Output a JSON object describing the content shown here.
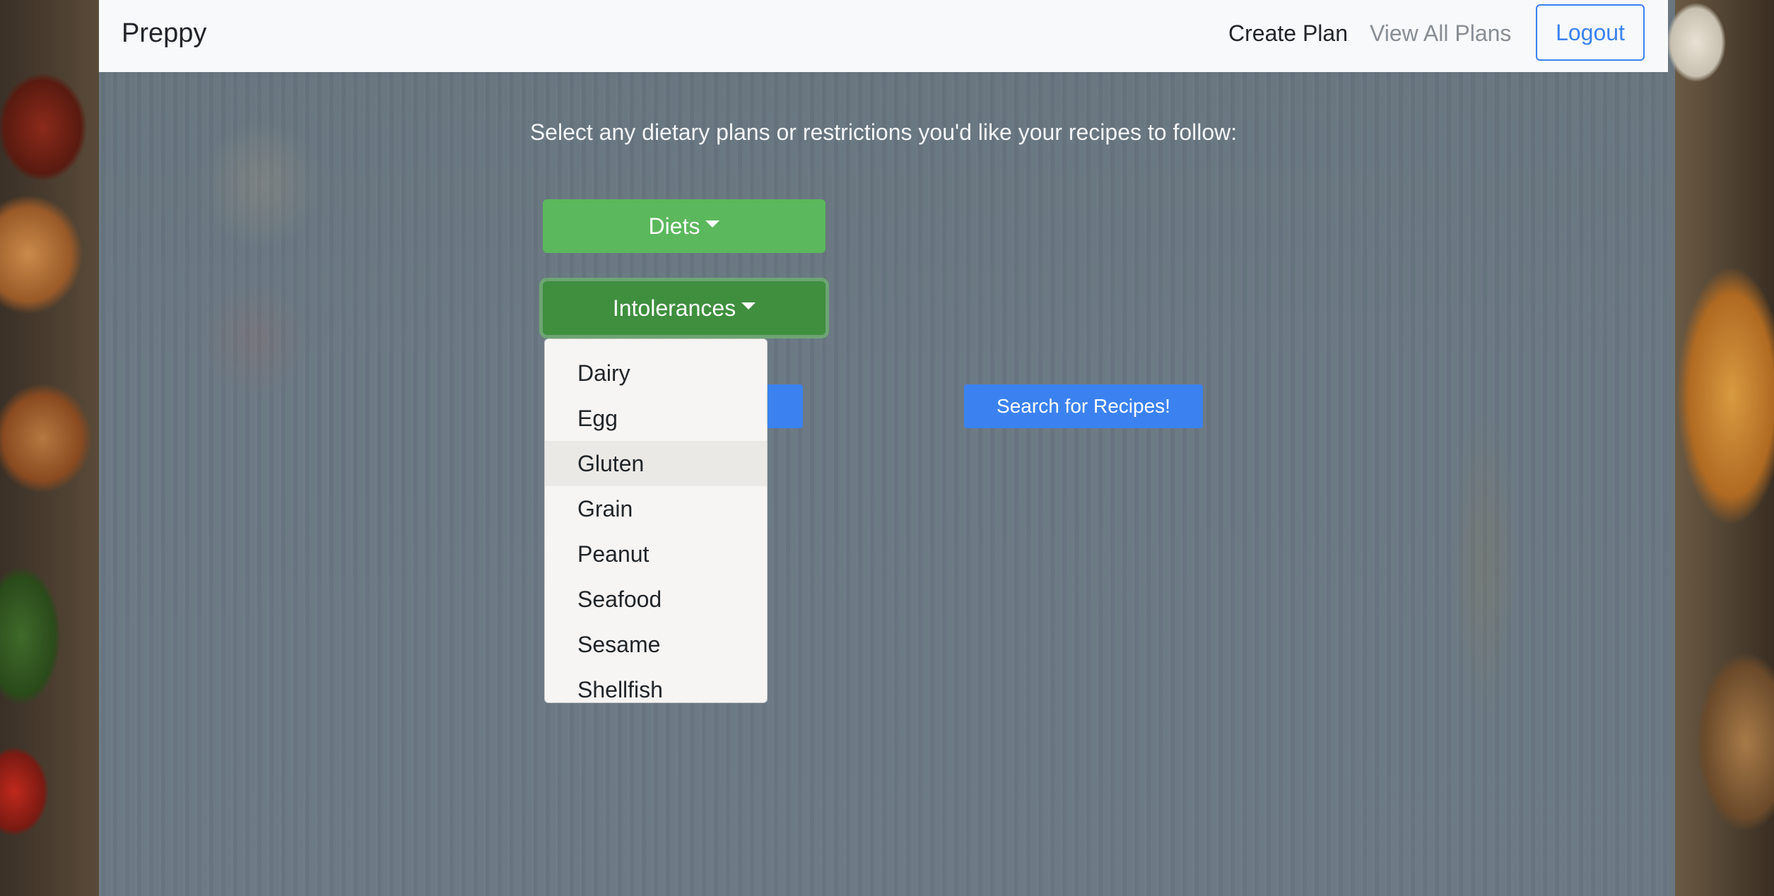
{
  "navbar": {
    "brand": "Preppy",
    "links": {
      "create_plan": "Create Plan",
      "view_all_plans": "View All Plans"
    },
    "logout_label": "Logout"
  },
  "main": {
    "prompt": "Select any dietary plans or restrictions you'd like your recipes to follow:",
    "diets_label": "Diets",
    "intolerances_label": "Intolerances",
    "search_label": "Search for Recipes!",
    "intolerances_menu": {
      "items": [
        "Dairy",
        "Egg",
        "Gluten",
        "Grain",
        "Peanut",
        "Seafood",
        "Sesame",
        "Shellfish"
      ],
      "highlighted": "Gluten"
    }
  },
  "colors": {
    "primary": "#3b82f0",
    "success": "#5cb85c",
    "success_active": "#3f8f3f",
    "navbar_bg": "#f8f9fa"
  },
  "icons": {
    "dropdown_caret": "caret-down-icon"
  }
}
